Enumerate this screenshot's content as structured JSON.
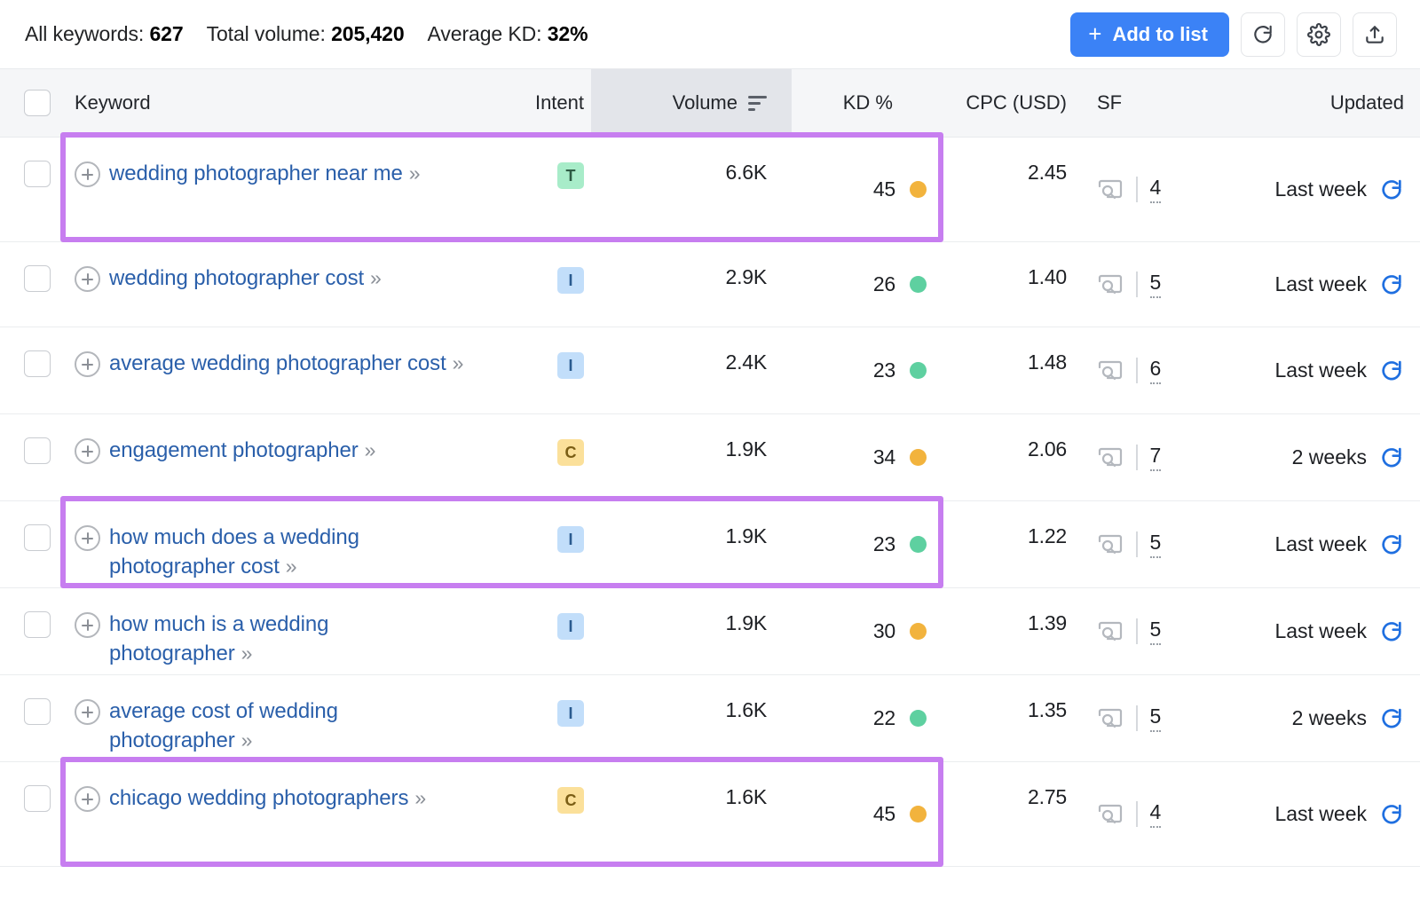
{
  "summary": {
    "all_keywords_label": "All keywords:",
    "all_keywords_value": "627",
    "total_volume_label": "Total volume:",
    "total_volume_value": "205,420",
    "average_kd_label": "Average KD:",
    "average_kd_value": "32%"
  },
  "toolbar": {
    "add_to_list_label": "Add to list",
    "add_to_list_plus": "+",
    "refresh_icon": "refresh-icon",
    "settings_icon": "gear-icon",
    "export_icon": "export-upload-icon"
  },
  "table": {
    "headers": {
      "keyword": "Keyword",
      "intent": "Intent",
      "volume": "Volume",
      "kd": "KD %",
      "cpc": "CPC (USD)",
      "sf": "SF",
      "updated": "Updated"
    },
    "sorted_column": "volume",
    "sort_icon": "sort-descending-icon",
    "expand_chevron": "»",
    "rows": [
      {
        "keyword": "wedding photographer near me",
        "intent": "T",
        "volume": "6.6K",
        "kd": "45",
        "kd_color": "#f2b33d",
        "cpc": "2.45",
        "sf": "4",
        "updated": "Last week",
        "highlighted": true
      },
      {
        "keyword": "wedding photographer cost",
        "intent": "I",
        "volume": "2.9K",
        "kd": "26",
        "kd_color": "#5ed0a0",
        "cpc": "1.40",
        "sf": "5",
        "updated": "Last week",
        "highlighted": false
      },
      {
        "keyword": "average wedding photographer cost",
        "intent": "I",
        "volume": "2.4K",
        "kd": "23",
        "kd_color": "#5ed0a0",
        "cpc": "1.48",
        "sf": "6",
        "updated": "Last week",
        "highlighted": false
      },
      {
        "keyword": "engagement photographer",
        "intent": "C",
        "volume": "1.9K",
        "kd": "34",
        "kd_color": "#f2b33d",
        "cpc": "2.06",
        "sf": "7",
        "updated": "2 weeks",
        "highlighted": false
      },
      {
        "keyword": "how much does a wedding photographer cost",
        "intent": "I",
        "volume": "1.9K",
        "kd": "23",
        "kd_color": "#5ed0a0",
        "cpc": "1.22",
        "sf": "5",
        "updated": "Last week",
        "highlighted": true
      },
      {
        "keyword": "how much is a wedding photographer",
        "intent": "I",
        "volume": "1.9K",
        "kd": "30",
        "kd_color": "#f2b33d",
        "cpc": "1.39",
        "sf": "5",
        "updated": "Last week",
        "highlighted": false
      },
      {
        "keyword": "average cost of wedding photographer",
        "intent": "I",
        "volume": "1.6K",
        "kd": "22",
        "kd_color": "#5ed0a0",
        "cpc": "1.35",
        "sf": "5",
        "updated": "2 weeks",
        "highlighted": false
      },
      {
        "keyword": "chicago wedding photographers",
        "intent": "C",
        "volume": "1.6K",
        "kd": "45",
        "kd_color": "#f2b33d",
        "cpc": "2.75",
        "sf": "4",
        "updated": "Last week",
        "highlighted": true
      }
    ]
  },
  "colors": {
    "accent_blue": "#3b82f6",
    "link_blue": "#2a5faa",
    "highlight_purple": "#c77ef0",
    "kd_easy_green": "#5ed0a0",
    "kd_medium_orange": "#f2b33d",
    "header_bg": "#f5f6f8",
    "sorted_col_bg": "#e3e5ea"
  }
}
